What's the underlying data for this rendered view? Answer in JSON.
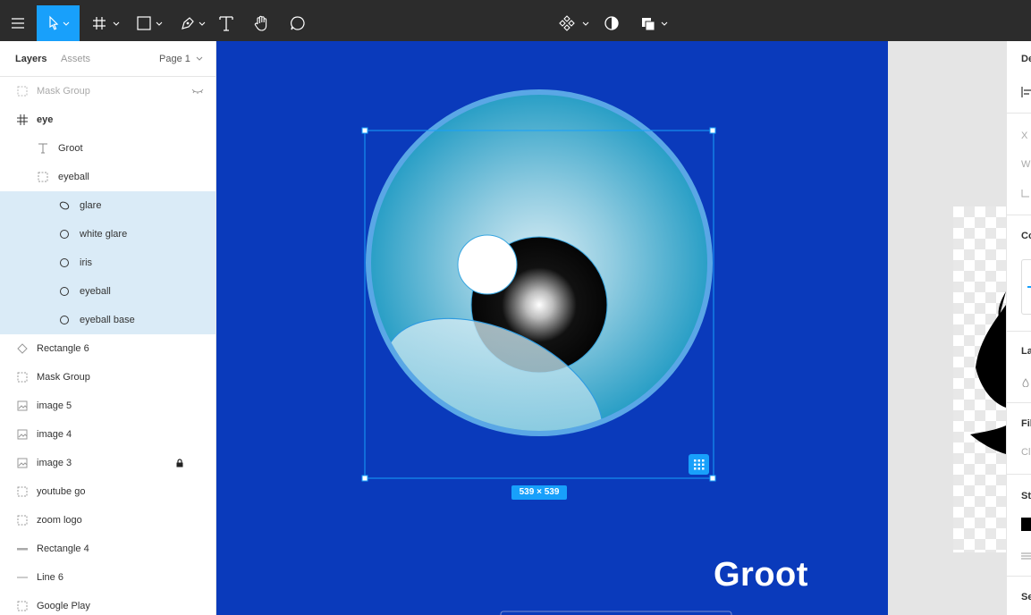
{
  "toolbar": {
    "tools": [
      {
        "name": "main-menu",
        "icon": "hamburger-icon"
      },
      {
        "name": "move-tool",
        "icon": "cursor-arrow-icon",
        "active": true
      },
      {
        "name": "frame-tool",
        "icon": "frame-hash-icon"
      },
      {
        "name": "shape-tool",
        "icon": "rectangle-icon"
      },
      {
        "name": "pen-tool",
        "icon": "pen-nib-icon"
      },
      {
        "name": "text-tool",
        "icon": "text-t-icon"
      },
      {
        "name": "hand-tool",
        "icon": "hand-icon"
      },
      {
        "name": "comment-tool",
        "icon": "comment-bubble-icon"
      },
      {
        "name": "components",
        "icon": "component-diamond-icon"
      },
      {
        "name": "mask",
        "icon": "mask-half-circle-icon"
      },
      {
        "name": "boolean",
        "icon": "boolean-squares-icon"
      }
    ],
    "accent": "#18a0fb",
    "bg": "#2c2c2c"
  },
  "sidebar": {
    "tabs": {
      "layers": "Layers",
      "assets": "Assets"
    },
    "page": "Page 1",
    "layers": [
      {
        "label": "Mask Group",
        "icon": "mask-group-icon",
        "muted": true,
        "hidden_icon": "eye-hidden-icon"
      },
      {
        "label": "eye",
        "icon": "frame-hash-icon",
        "bold": true
      },
      {
        "label": "Groot",
        "icon": "text-t-icon"
      },
      {
        "label": "eyeball",
        "icon": "group-dashed-icon"
      },
      {
        "label": "glare",
        "icon": "ellipse-icon",
        "selected": true
      },
      {
        "label": "white glare",
        "icon": "ellipse-icon",
        "selected": true
      },
      {
        "label": "iris",
        "icon": "ellipse-icon",
        "selected": true
      },
      {
        "label": "eyeball",
        "icon": "ellipse-icon",
        "selected": true
      },
      {
        "label": "eyeball base",
        "icon": "ellipse-icon",
        "selected": true
      },
      {
        "label": "Rectangle 6",
        "icon": "diamond-icon"
      },
      {
        "label": "Mask Group",
        "icon": "group-dashed-icon"
      },
      {
        "label": "image 5",
        "icon": "image-icon"
      },
      {
        "label": "image 4",
        "icon": "image-icon"
      },
      {
        "label": "image 3",
        "icon": "image-icon",
        "locked": true
      },
      {
        "label": "youtube go",
        "icon": "group-dashed-icon"
      },
      {
        "label": "zoom logo",
        "icon": "group-dashed-icon"
      },
      {
        "label": "Rectangle 4",
        "icon": "line-icon"
      },
      {
        "label": "Line 6",
        "icon": "line-icon"
      },
      {
        "label": "Google Play",
        "icon": "group-dashed-icon"
      }
    ],
    "selection_color": "#daebf7"
  },
  "canvas": {
    "bg": "#0a3abb",
    "size_badge": "539 × 539",
    "frame_text": "Groot",
    "selection_color": "#18a0fb"
  },
  "properties": {
    "labels": [
      "De",
      "X",
      "W",
      "Co",
      "La",
      "Fil",
      "Cli",
      "St",
      "Se"
    ]
  }
}
